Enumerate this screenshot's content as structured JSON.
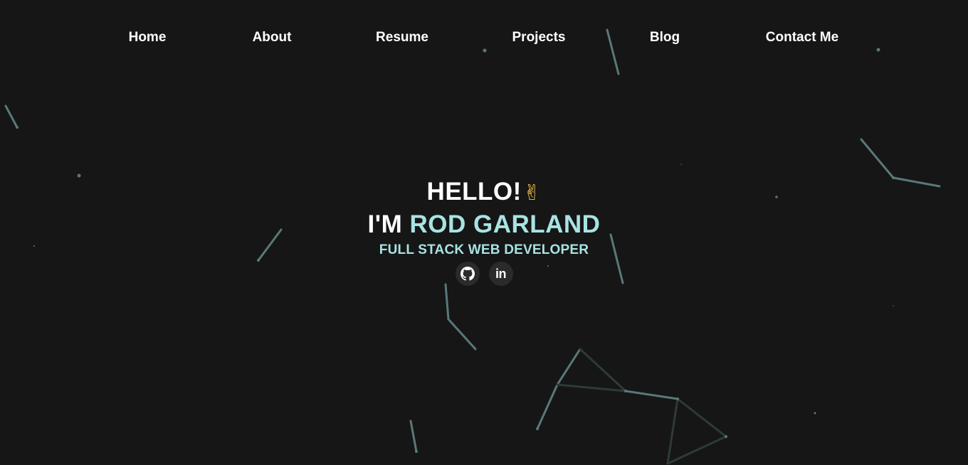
{
  "nav": {
    "items": [
      {
        "label": "Home"
      },
      {
        "label": "About"
      },
      {
        "label": "Resume"
      },
      {
        "label": "Projects"
      },
      {
        "label": "Blog"
      },
      {
        "label": "Contact Me"
      }
    ]
  },
  "hero": {
    "greeting": "HELLO!",
    "greeting_emoji": "✌",
    "intro_prefix": "I'M",
    "name": "ROD GARLAND",
    "role": "FULL STACK WEB DEVELOPER"
  },
  "socials": [
    {
      "icon": "github-icon"
    },
    {
      "icon": "linkedin-icon",
      "glyph": "in"
    }
  ],
  "colors": {
    "background": "#161616",
    "accent": "#a8e3e3",
    "particles": "#5a7878",
    "social_bg": "#2b2b2b"
  }
}
